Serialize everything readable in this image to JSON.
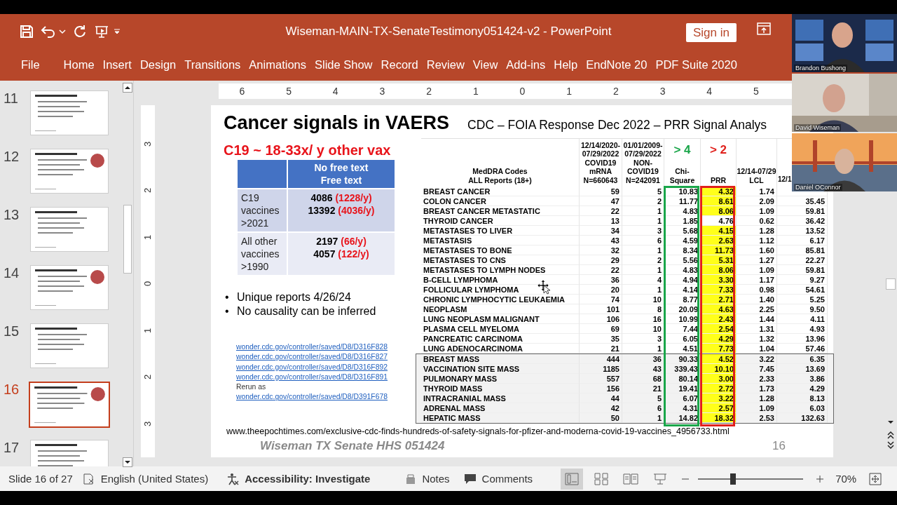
{
  "window": {
    "title": "Wiseman-MAIN-TX-SenateTestimony051424-v2  -  PowerPoint",
    "sign_in": "Sign in"
  },
  "ribbon": {
    "file_tab": "File",
    "tabs": [
      "Home",
      "Insert",
      "Design",
      "Transitions",
      "Animations",
      "Slide Show",
      "Record",
      "Review",
      "View",
      "Add-ins",
      "Help",
      "EndNote 20",
      "PDF Suite 2020"
    ]
  },
  "slides": [
    {
      "number": "11",
      "selected": false
    },
    {
      "number": "12",
      "selected": false
    },
    {
      "number": "13",
      "selected": false
    },
    {
      "number": "14",
      "selected": false
    },
    {
      "number": "15",
      "selected": false
    },
    {
      "number": "16",
      "selected": true
    },
    {
      "number": "17",
      "selected": false
    }
  ],
  "rulers": {
    "horizontal": [
      "6",
      "5",
      "4",
      "3",
      "2",
      "1",
      "0",
      "1",
      "2",
      "3",
      "4",
      "5"
    ],
    "vertical": [
      "3",
      "2",
      "1",
      "0",
      "1",
      "2",
      "3"
    ]
  },
  "slide": {
    "title": "Cancer signals in VAERS",
    "subtitle": "CDC – FOIA Response Dec 2022 – PRR Signal Analys",
    "headline": "C19 ~ 18-33x/ y other vax",
    "summary": {
      "header": "No free text\nFree text",
      "rows": [
        {
          "label": "C19\nvaccines\n>2021",
          "values": [
            {
              "count": "4086",
              "rate": "(1228/y)"
            },
            {
              "count": "13392",
              "rate": "(4036/y)"
            }
          ]
        },
        {
          "label": "All other\nvaccines\n>1990",
          "values": [
            {
              "count": "2197",
              "rate": "(66/y)"
            },
            {
              "count": "4057",
              "rate": "(122/y)"
            }
          ]
        }
      ]
    },
    "bullets": [
      {
        "marker": "•",
        "text": "Unique reports 4/26/24"
      },
      {
        "marker": "•",
        "text": "No causality can be inferred"
      }
    ],
    "links": [
      {
        "kind": "link",
        "text": "wonder.cdc.gov/controller/saved/D8/D316F828"
      },
      {
        "kind": "link",
        "text": "wonder.cdc.gov/controller/saved/D8/D316F827"
      },
      {
        "kind": "link",
        "text": "wonder.cdc.gov/controller/saved/D8/D316F892"
      },
      {
        "kind": "link",
        "text": "wonder.cdc.gov/controller/saved/D8/D316F891"
      },
      {
        "kind": "note",
        "text": "Rerun as"
      },
      {
        "kind": "link",
        "text": "wonder.cdc.gov/controller/saved/D8/D391F678"
      }
    ],
    "source_url": "www.theepochtimes.com/exclusive-cdc-finds-hundreds-of-safety-signals-for-pfizer-and-moderna-covid-19-vaccines_4956733.html",
    "footer": "Wiseman TX Senate HHS 051424",
    "page_number": "16"
  },
  "table": {
    "columns": [
      {
        "label": "MedDRA Codes\nALL Reports (18+)"
      },
      {
        "label": "12/14/2020-\n07/29/2022\nCOVID19\nmRNA\nN=660643"
      },
      {
        "label": "01/01/2009-\n07/29/2022\nNON-\nCOVID19\nN=242091"
      },
      {
        "label": "Chi-\nSquare",
        "threshold": "> 4",
        "color": "#1aa64a"
      },
      {
        "label": "PRR",
        "threshold": "> 2",
        "color": "#e0201b"
      },
      {
        "label": "12/14-07/29\nLCL"
      },
      {
        "label": "12/1"
      }
    ],
    "rows": [
      {
        "cells": [
          "BREAST CANCER",
          "59",
          "5",
          "10.83",
          "4.32",
          "1.74"
        ],
        "highlighted": true
      },
      {
        "cells": [
          "COLON CANCER",
          "47",
          "2",
          "11.77",
          "8.61",
          "2.09",
          "35.45"
        ],
        "highlighted": true
      },
      {
        "cells": [
          "BREAST CANCER METASTATIC",
          "22",
          "1",
          "4.83",
          "8.06",
          "1.09",
          "59.81"
        ],
        "highlighted": true
      },
      {
        "cells": [
          "THYROID CANCER",
          "13",
          "1",
          "1.85",
          "4.76",
          "0.62",
          "36.42"
        ],
        "highlighted": false
      },
      {
        "cells": [
          "METASTASES TO LIVER",
          "34",
          "3",
          "5.68",
          "4.15",
          "1.28",
          "13.52"
        ],
        "highlighted": true
      },
      {
        "cells": [
          "METASTASIS",
          "43",
          "6",
          "4.59",
          "2.63",
          "1.12",
          "6.17"
        ],
        "highlighted": true
      },
      {
        "cells": [
          "METASTASES TO BONE",
          "32",
          "1",
          "8.34",
          "11.73",
          "1.60",
          "85.81"
        ],
        "highlighted": true
      },
      {
        "cells": [
          "METASTASES TO CNS",
          "29",
          "2",
          "5.56",
          "5.31",
          "1.27",
          "22.27"
        ],
        "highlighted": true
      },
      {
        "cells": [
          "METASTASES TO LYMPH NODES",
          "22",
          "1",
          "4.83",
          "8.06",
          "1.09",
          "59.81"
        ],
        "highlighted": true
      },
      {
        "cells": [
          "B-CELL LYMPHOMA",
          "36",
          "4",
          "4.94",
          "3.30",
          "1.17",
          "9.27"
        ],
        "highlighted": true
      },
      {
        "cells": [
          "FOLLICULAR LYMPHOMA",
          "20",
          "1",
          "4.14",
          "7.33",
          "0.98",
          "54.61"
        ],
        "highlighted": true
      },
      {
        "cells": [
          "CHRONIC LYMPHOCYTIC LEUKAEMIA",
          "74",
          "10",
          "8.77",
          "2.71",
          "1.40",
          "5.25"
        ],
        "highlighted": true
      },
      {
        "cells": [
          "NEOPLASM",
          "101",
          "8",
          "20.09",
          "4.63",
          "2.25",
          "9.50"
        ],
        "highlighted": true
      },
      {
        "cells": [
          "LUNG NEOPLASM MALIGNANT",
          "106",
          "16",
          "10.99",
          "2.43",
          "1.44",
          "4.11"
        ],
        "highlighted": true
      },
      {
        "cells": [
          "PLASMA CELL MYELOMA",
          "69",
          "10",
          "7.44",
          "2.54",
          "1.31",
          "4.93"
        ],
        "highlighted": true
      },
      {
        "cells": [
          "PANCREATIC CARCINOMA",
          "35",
          "3",
          "6.05",
          "4.29",
          "1.32",
          "13.96"
        ],
        "highlighted": true
      },
      {
        "cells": [
          "LUNG ADENOCARCINOMA",
          "21",
          "1",
          "4.51",
          "7.73",
          "1.04",
          "57.46"
        ],
        "highlighted": true
      }
    ],
    "boxed_rows": [
      {
        "cells": [
          "BREAST MASS",
          "444",
          "36",
          "90.33",
          "4.52",
          "3.22",
          "6.35"
        ],
        "highlighted": true
      },
      {
        "cells": [
          "VACCINATION SITE MASS",
          "1185",
          "43",
          "339.43",
          "10.10",
          "7.45",
          "13.69"
        ],
        "highlighted": true
      },
      {
        "cells": [
          "PULMONARY MASS",
          "557",
          "68",
          "80.14",
          "3.00",
          "2.33",
          "3.86"
        ],
        "highlighted": true
      },
      {
        "cells": [
          "THYROID MASS",
          "156",
          "21",
          "19.41",
          "2.72",
          "1.73",
          "4.29"
        ],
        "highlighted": true
      },
      {
        "cells": [
          "INTRACRANIAL MASS",
          "44",
          "5",
          "6.07",
          "3.22",
          "1.28",
          "8.13"
        ],
        "highlighted": true
      },
      {
        "cells": [
          "ADRENAL MASS",
          "42",
          "6",
          "4.31",
          "2.57",
          "1.09",
          "6.03"
        ],
        "highlighted": true
      },
      {
        "cells": [
          "HEPATIC MASS",
          "50",
          "1",
          "14.82",
          "18.32",
          "2.53",
          "132.63"
        ],
        "highlighted": true
      }
    ]
  },
  "participants": [
    {
      "name": "Brandon Bushong"
    },
    {
      "name": "David Wiseman"
    },
    {
      "name": "Daniel OConnor"
    }
  ],
  "status_bar": {
    "slide_info": "Slide 16 of 27",
    "language": "English (United States)",
    "accessibility": "Accessibility: Investigate",
    "notes": "Notes",
    "comments": "Comments",
    "views": [
      {
        "kind": "normal",
        "selected": true
      },
      {
        "kind": "sorter",
        "selected": false
      },
      {
        "kind": "reading",
        "selected": false
      },
      {
        "kind": "slideshow",
        "selected": false
      }
    ],
    "zoom": {
      "level": 0.33,
      "reading": "70%"
    }
  }
}
